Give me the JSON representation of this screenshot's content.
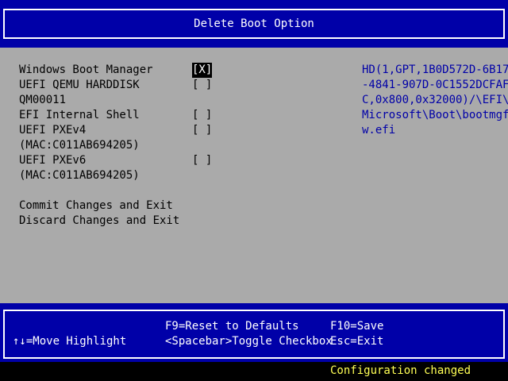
{
  "header": {
    "title": "Delete Boot Option"
  },
  "boot_options": [
    {
      "label_lines": [
        "Windows Boot Manager"
      ],
      "checkbox": "[X]",
      "checked": true,
      "highlighted": true
    },
    {
      "label_lines": [
        "UEFI QEMU HARDDISK",
        "QM00011"
      ],
      "checkbox": "[ ]",
      "checked": false,
      "highlighted": false
    },
    {
      "label_lines": [
        "EFI Internal Shell"
      ],
      "checkbox": "[ ]",
      "checked": false,
      "highlighted": false
    },
    {
      "label_lines": [
        "UEFI PXEv4",
        "(MAC:C011AB694205)"
      ],
      "checkbox": "[ ]",
      "checked": false,
      "highlighted": false
    },
    {
      "label_lines": [
        "UEFI PXEv6",
        "(MAC:C011AB694205)"
      ],
      "checkbox": "[ ]",
      "checked": false,
      "highlighted": false
    }
  ],
  "actions": {
    "commit": "Commit Changes and Exit",
    "discard": "Discard Changes and Exit"
  },
  "help_lines": [
    "HD(1,GPT,1B0D572D-6B17",
    "-4841-907D-0C1552DCFAF",
    "C,0x800,0x32000)/\\EFI\\",
    "Microsoft\\Boot\\bootmgf",
    "w.efi"
  ],
  "footer": {
    "move_highlight": "↑↓=Move Highlight",
    "reset_defaults": "F9=Reset to Defaults",
    "toggle_checkbox": "<Spacebar>Toggle Checkbox",
    "save": "F10=Save",
    "exit": "Esc=Exit"
  },
  "status": {
    "message": "Configuration changed"
  },
  "colors": {
    "background": "#aaaaaa",
    "title_bar": "#0000a8",
    "help_text": "#0000a8",
    "status_text": "#ffff55",
    "highlight_bg": "#000000"
  }
}
